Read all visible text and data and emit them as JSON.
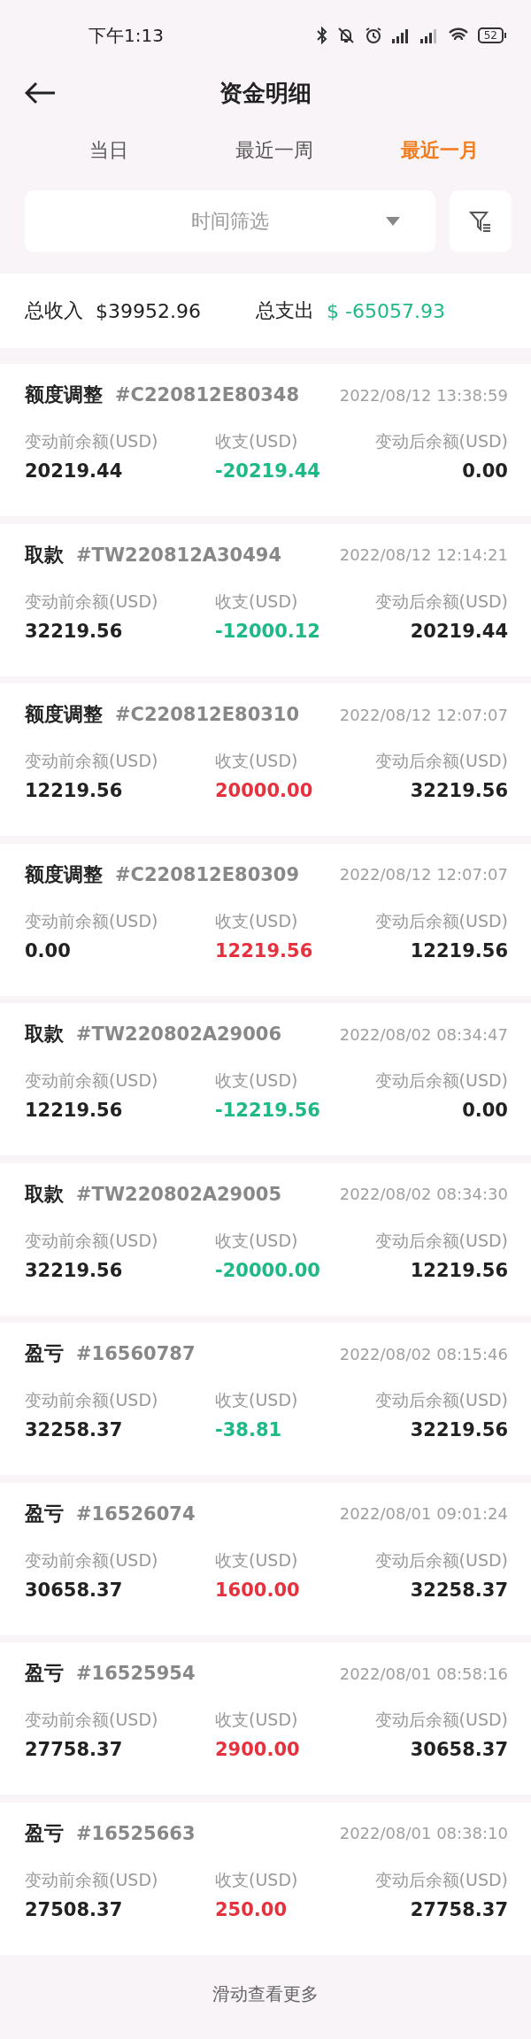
{
  "status_bar": {
    "time": "下午1:13",
    "battery": "52"
  },
  "header": {
    "title": "资金明细"
  },
  "tabs": [
    {
      "label": "当日",
      "selected": false
    },
    {
      "label": "最近一周",
      "selected": false
    },
    {
      "label": "最近一月",
      "selected": true
    }
  ],
  "filter": {
    "placeholder": "时间筛选"
  },
  "summary": {
    "income_label": "总收入",
    "income": "$39952.96",
    "expense_label": "总支出",
    "expense": "$ -65057.93"
  },
  "records": [
    {
      "type": "额度调整",
      "id": "#C220812E80348",
      "time": "2022/08/12 13:38:59",
      "before_label": "变动前余额(USD)",
      "before": "20219.44",
      "amount_label": "收支(USD)",
      "amount": "-20219.44",
      "color": "#1fb887",
      "after_label": "变动后余额(USD)",
      "after": "0.00"
    },
    {
      "type": "取款",
      "id": "#TW220812A30494",
      "time": "2022/08/12 12:14:21",
      "before_label": "变动前余额(USD)",
      "before": "32219.56",
      "amount_label": "收支(USD)",
      "amount": "-12000.12",
      "color": "#1fb887",
      "after_label": "变动后余额(USD)",
      "after": "20219.44"
    },
    {
      "type": "额度调整",
      "id": "#C220812E80310",
      "time": "2022/08/12 12:07:07",
      "before_label": "变动前余额(USD)",
      "before": "12219.56",
      "amount_label": "收支(USD)",
      "amount": "20000.00",
      "color": "#e5323e",
      "after_label": "变动后余额(USD)",
      "after": "32219.56"
    },
    {
      "type": "额度调整",
      "id": "#C220812E80309",
      "time": "2022/08/12 12:07:07",
      "before_label": "变动前余额(USD)",
      "before": "0.00",
      "amount_label": "收支(USD)",
      "amount": "12219.56",
      "color": "#e5323e",
      "after_label": "变动后余额(USD)",
      "after": "12219.56"
    },
    {
      "type": "取款",
      "id": "#TW220802A29006",
      "time": "2022/08/02 08:34:47",
      "before_label": "变动前余额(USD)",
      "before": "12219.56",
      "amount_label": "收支(USD)",
      "amount": "-12219.56",
      "color": "#1fb887",
      "after_label": "变动后余额(USD)",
      "after": "0.00"
    },
    {
      "type": "取款",
      "id": "#TW220802A29005",
      "time": "2022/08/02 08:34:30",
      "before_label": "变动前余额(USD)",
      "before": "32219.56",
      "amount_label": "收支(USD)",
      "amount": "-20000.00",
      "color": "#1fb887",
      "after_label": "变动后余额(USD)",
      "after": "12219.56"
    },
    {
      "type": "盈亏",
      "id": "#16560787",
      "time": "2022/08/02 08:15:46",
      "before_label": "变动前余额(USD)",
      "before": "32258.37",
      "amount_label": "收支(USD)",
      "amount": "-38.81",
      "color": "#1fb887",
      "after_label": "变动后余额(USD)",
      "after": "32219.56"
    },
    {
      "type": "盈亏",
      "id": "#16526074",
      "time": "2022/08/01 09:01:24",
      "before_label": "变动前余额(USD)",
      "before": "30658.37",
      "amount_label": "收支(USD)",
      "amount": "1600.00",
      "color": "#e5323e",
      "after_label": "变动后余额(USD)",
      "after": "32258.37"
    },
    {
      "type": "盈亏",
      "id": "#16525954",
      "time": "2022/08/01 08:58:16",
      "before_label": "变动前余额(USD)",
      "before": "27758.37",
      "amount_label": "收支(USD)",
      "amount": "2900.00",
      "color": "#e5323e",
      "after_label": "变动后余额(USD)",
      "after": "30658.37"
    },
    {
      "type": "盈亏",
      "id": "#16525663",
      "time": "2022/08/01 08:38:10",
      "before_label": "变动前余额(USD)",
      "before": "27508.37",
      "amount_label": "收支(USD)",
      "amount": "250.00",
      "color": "#e5323e",
      "after_label": "变动后余额(USD)",
      "after": "27758.37"
    }
  ],
  "footer": {
    "text": "滑动查看更多"
  }
}
